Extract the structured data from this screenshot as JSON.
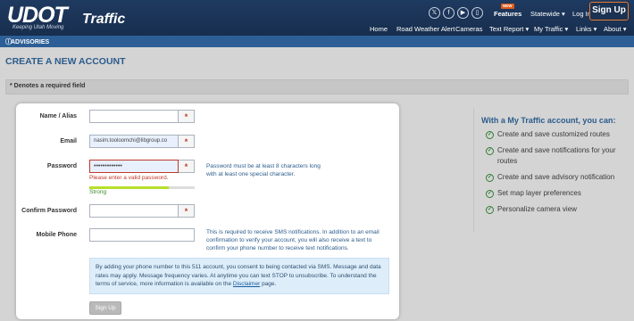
{
  "header": {
    "logo": "UDOT",
    "logo_tagline": "Keeping Utah Moving",
    "product": "Traffic",
    "social_icons": [
      "x-icon",
      "facebook-icon",
      "youtube-icon",
      "mobile-icon"
    ],
    "features_badge": "NEW",
    "features": "Features",
    "region": "Statewide",
    "login": "Log In",
    "signup": "Sign Up",
    "nav": [
      "Home",
      "Road Weather Alert",
      "Cameras",
      "Text Report",
      "My Traffic",
      "Links",
      "About"
    ]
  },
  "advisories": {
    "label": "ADVISORIES"
  },
  "page": {
    "title": "CREATE A NEW ACCOUNT",
    "required_note": "* Denotes a required field"
  },
  "form": {
    "name_label": "Name / Alias",
    "name_value": "",
    "email_label": "Email",
    "email_value": "nasim.tooloomchi@libgroup.co",
    "password_label": "Password",
    "password_value": "•••••••••••••",
    "password_error": "Please enter a valid password.",
    "password_hint": "Password must be at least 8 characters long with at least one special character.",
    "strength_label": "Strong",
    "strength_fraction": 0.75,
    "confirm_label": "Confirm Password",
    "confirm_value": "",
    "phone_label": "Mobile Phone",
    "phone_value": "",
    "phone_hint": "This is required to receive SMS notifications. In addition to an email confirmation to verify your account, you will also receive a text to confirm your phone number to receive text notifications.",
    "required_mark": "*",
    "notice_text": "By adding your phone number to this 511 account, you consent to being contacted via SMS. Message and data rates may apply. Message frequency varies. At anytime you can text STOP to unsubscribe. To understand the terms of service, more information is available on the",
    "notice_link": "Disclaimer",
    "notice_end": "page.",
    "submit": "Sign Up"
  },
  "perks": {
    "title": "With a My Traffic account, you can:",
    "items": [
      "Create and save customized routes",
      "Create and save notifications for your routes",
      "Create and save advisory notification",
      "Set map layer preferences",
      "Personalize camera view"
    ]
  },
  "colors": {
    "header": "#1f3a60",
    "accent": "#e8792c",
    "title": "#2b5c8c",
    "error": "#c0392b",
    "strength": "#b6e02a"
  }
}
